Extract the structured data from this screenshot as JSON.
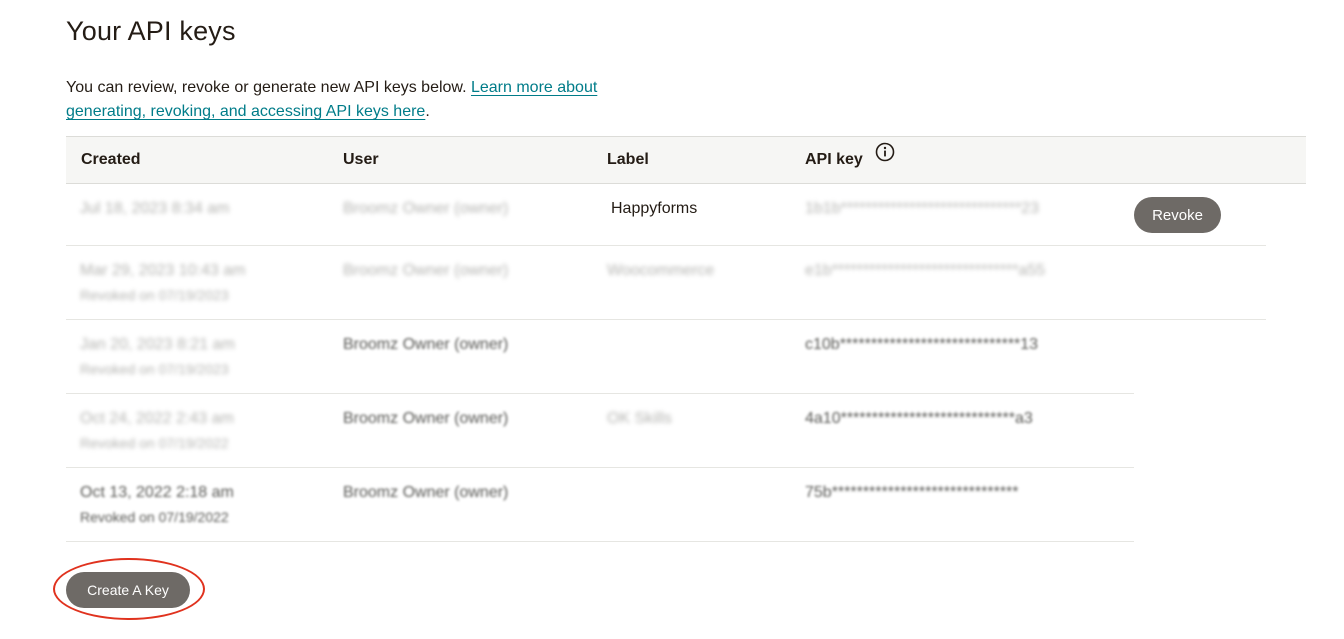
{
  "page": {
    "title": "Your API keys",
    "intro_text": "You can review, revoke or generate new API keys below. ",
    "learn_more_link": "Learn more about generating, revoking, and accessing API keys here",
    "intro_end": "."
  },
  "table": {
    "columns": {
      "created": "Created",
      "user": "User",
      "label": "Label",
      "api_key": "API key"
    },
    "info_icon": "info-icon",
    "rows": [
      {
        "created": "Jul 18, 2023 8:34 am",
        "created_sub": "",
        "user": "Broomz Owner (owner)",
        "label": "Happyforms",
        "api_key": "1b1b*****************************23",
        "action": "Revoke"
      },
      {
        "created": "Mar 29, 2023 10:43 am",
        "created_sub": "Revoked on 07/19/2023",
        "user": "Broomz Owner (owner)",
        "label": "Woocommerce",
        "api_key": "e1b******************************a55",
        "action": ""
      },
      {
        "created": "Jan 20, 2023 8:21 am",
        "created_sub": "Revoked on 07/19/2023",
        "user": "Broomz Owner (owner)",
        "label": "",
        "api_key": "c10b*****************************13",
        "action": ""
      },
      {
        "created": "Oct 24, 2022 2:43 am",
        "created_sub": "Revoked on 07/19/2022",
        "user": "Broomz Owner (owner)",
        "label": "OK Skills",
        "api_key": "4a10****************************a3",
        "action": ""
      },
      {
        "created": "Oct 13, 2022 2:18 am",
        "created_sub": "Revoked on 07/19/2022",
        "user": "Broomz Owner (owner)",
        "label": "",
        "api_key": "75b******************************",
        "action": ""
      }
    ]
  },
  "actions": {
    "create_key": "Create A Key"
  },
  "colors": {
    "text": "#241c15",
    "link": "#007c89",
    "button_bg": "#6e6a66",
    "header_bg": "#f6f6f4",
    "highlight": "#e0321e"
  }
}
